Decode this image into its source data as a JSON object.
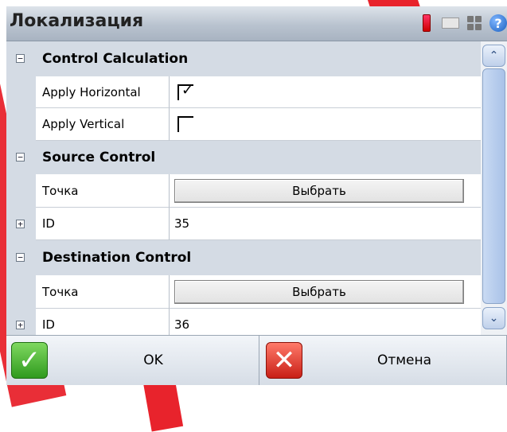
{
  "window": {
    "title": "Локализация"
  },
  "status_icons": [
    "battery-icon",
    "keyboard-icon",
    "apps-grid-icon",
    "help-icon"
  ],
  "grid": {
    "rows": [
      {
        "kind": "category",
        "expander": "−",
        "label": "Control Calculation"
      },
      {
        "kind": "checkbox",
        "name": "Apply Horizontal",
        "checked": true,
        "mark": "✓"
      },
      {
        "kind": "checkbox",
        "name": "Apply Vertical",
        "checked": false
      },
      {
        "kind": "category",
        "expander": "−",
        "label": "Source Control"
      },
      {
        "kind": "button",
        "name": "Точка",
        "button_label": "Выбрать"
      },
      {
        "kind": "text",
        "expander": "+",
        "name": "ID",
        "value": "35"
      },
      {
        "kind": "category",
        "expander": "−",
        "label": "Destination Control"
      },
      {
        "kind": "button",
        "name": "Точка",
        "button_label": "Выбрать"
      },
      {
        "kind": "text",
        "expander": "+",
        "name": "ID",
        "value": "36"
      }
    ]
  },
  "scrollbar": {
    "up_glyph": "⌃",
    "down_glyph": "⌄"
  },
  "buttons": {
    "ok": {
      "label": "OK",
      "glyph": "✓"
    },
    "cancel": {
      "label": "Отмена",
      "glyph": "✕"
    }
  },
  "colors": {
    "accent_red": "#e8232c",
    "category_bg": "#d4dbe4",
    "ok_green": "#2f9a1e",
    "cancel_red": "#c81f16"
  }
}
